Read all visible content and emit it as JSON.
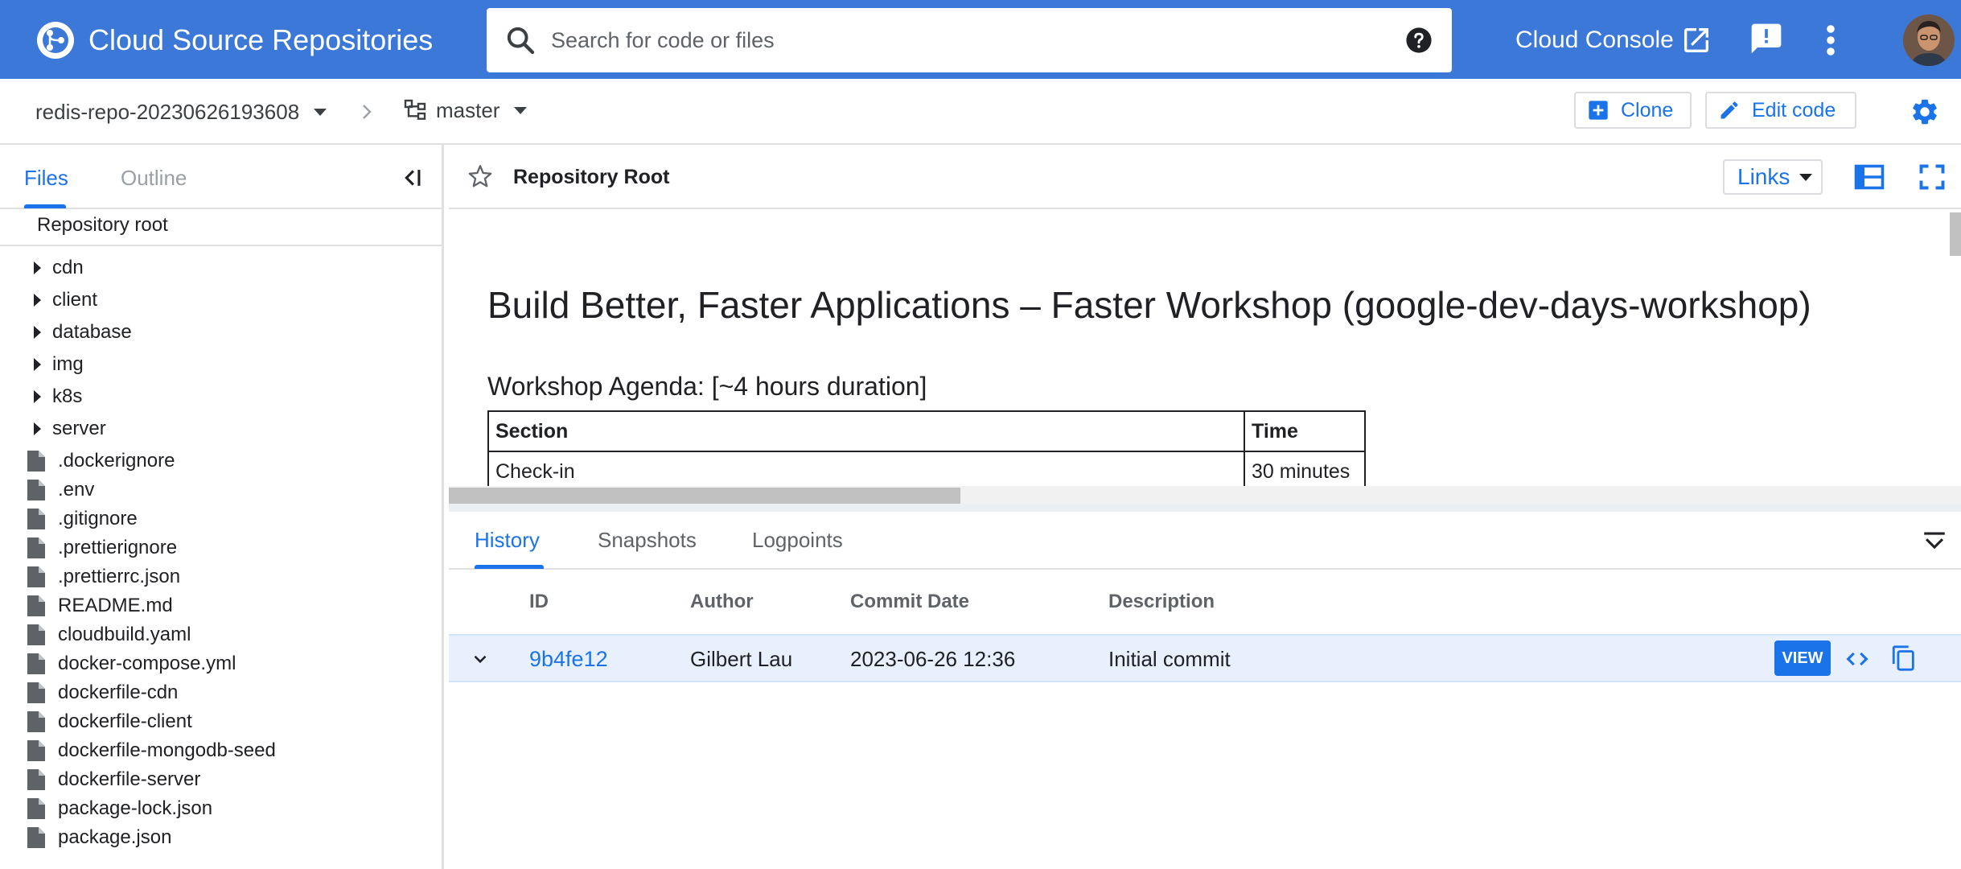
{
  "header": {
    "app_title": "Cloud Source Repositories",
    "search_placeholder": "Search for code or files",
    "console_link": "Cloud Console",
    "icons": [
      "source-repositories-logo-icon",
      "search-icon",
      "help-icon",
      "open-in-new-icon",
      "feedback-icon",
      "more-vert-icon"
    ]
  },
  "breadcrumb": {
    "repo": "redis-repo-20230626193608",
    "branch": "master",
    "clone_label": "Clone",
    "edit_label": "Edit code"
  },
  "sidebar": {
    "tabs": [
      "Files",
      "Outline"
    ],
    "active_tab": "Files",
    "root_label": "Repository root",
    "folders": [
      "cdn",
      "client",
      "database",
      "img",
      "k8s",
      "server"
    ],
    "files": [
      ".dockerignore",
      ".env",
      ".gitignore",
      ".prettierignore",
      ".prettierrc.json",
      "README.md",
      "cloudbuild.yaml",
      "docker-compose.yml",
      "dockerfile-cdn",
      "dockerfile-client",
      "dockerfile-mongodb-seed",
      "dockerfile-server",
      "package-lock.json",
      "package.json"
    ]
  },
  "main": {
    "title": "Repository Root",
    "links_label": "Links"
  },
  "readme": {
    "heading": "Build Better, Faster Applications – Faster Workshop (google-dev-days-workshop)",
    "subheading": "Workshop Agenda: [~4 hours duration]",
    "table_headers": [
      "Section",
      "Time"
    ],
    "table_rows": [
      [
        "Check-in",
        "30 minutes"
      ]
    ]
  },
  "history": {
    "tabs": [
      "History",
      "Snapshots",
      "Logpoints"
    ],
    "active_tab": "History",
    "columns": [
      "ID",
      "Author",
      "Commit Date",
      "Description"
    ],
    "rows": [
      {
        "id": "9b4fe12",
        "author": "Gilbert Lau",
        "date": "2023-06-26 12:36",
        "description": "Initial commit",
        "view_label": "VIEW"
      }
    ]
  },
  "colors": {
    "header_bg": "#3c78d8",
    "accent": "#1a73e8",
    "selected_row_bg": "#e8f0fe"
  }
}
